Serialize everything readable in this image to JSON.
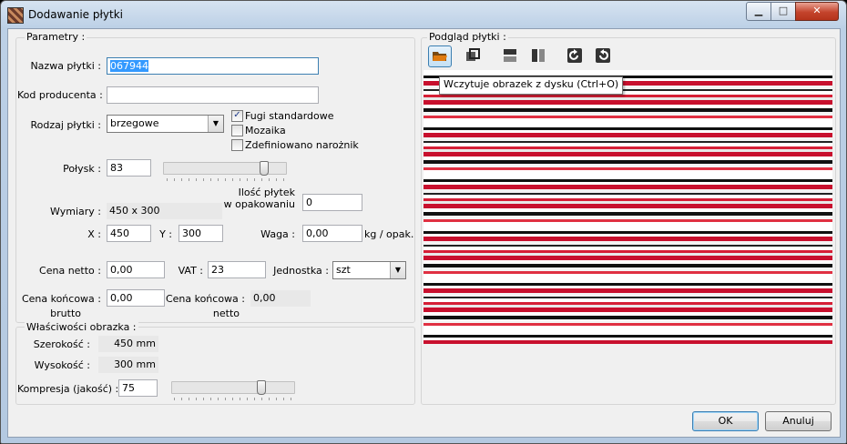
{
  "window": {
    "title": "Dodawanie płytki",
    "minimize_glyph": "▁",
    "maximize_glyph": "□",
    "close_glyph": "✕"
  },
  "params": {
    "legend": "Parametry :",
    "name_label": "Nazwa płytki :",
    "name_value": "067944",
    "producer_code_label": "Kod producenta :",
    "producer_code_value": "",
    "type_label": "Rodzaj płytki :",
    "type_value": "brzegowe",
    "checkboxes": [
      {
        "label": "Fugi standardowe",
        "checked": true
      },
      {
        "label": "Mozaika",
        "checked": false
      },
      {
        "label": "Zdefiniowano narożnik",
        "checked": false
      }
    ],
    "gloss_label": "Połysk :",
    "gloss_value": "83",
    "gloss_level_percent": 83,
    "dims_label": "Wymiary :",
    "dims_value": "450 x 300",
    "x_label": "X :",
    "x_value": "450",
    "y_label": "Y :",
    "y_value": "300",
    "pkg_count_label_1": "Ilość płytek",
    "pkg_count_label_2": "w opakowaniu",
    "pkg_count_value": "0",
    "weight_label": "Waga :",
    "weight_value": "0,00",
    "weight_unit": "kg / opak.",
    "net_price_label": "Cena netto :",
    "net_price_value": "0,00",
    "vat_label": "VAT :",
    "vat_value": "23",
    "unit_label": "Jednostka :",
    "unit_value": "szt",
    "gross_label_1": "Cena końcowa :",
    "gross_label_2": "brutto",
    "gross_value": "0,00",
    "final_net_label_1": "Cena końcowa :",
    "final_net_label_2": "netto",
    "final_net_value": "0,00"
  },
  "image_props": {
    "legend": "Właściwości obrazka :",
    "width_label": "Szerokość :",
    "width_value": "450 mm",
    "height_label": "Wysokość :",
    "height_value": "300 mm",
    "compression_label": "Kompresja (jakość) :",
    "compression_value": "75",
    "compression_level_percent": 75
  },
  "preview": {
    "legend": "Podgląd płytki :",
    "tools": [
      "open-folder-icon",
      "crop-icon",
      "flip-vertical-icon",
      "flip-horizontal-icon",
      "rotate-right-icon",
      "rotate-left-icon"
    ],
    "tooltip": "Wczytuje obrazek z dysku (Ctrl+O)"
  },
  "buttons": {
    "ok": "OK",
    "cancel": "Anuluj"
  },
  "colors": {
    "stripe_red": "#c8102e",
    "stripe_black": "#111111",
    "tool_orange": "#e07b10",
    "tool_blue": "#2a5ea8"
  }
}
